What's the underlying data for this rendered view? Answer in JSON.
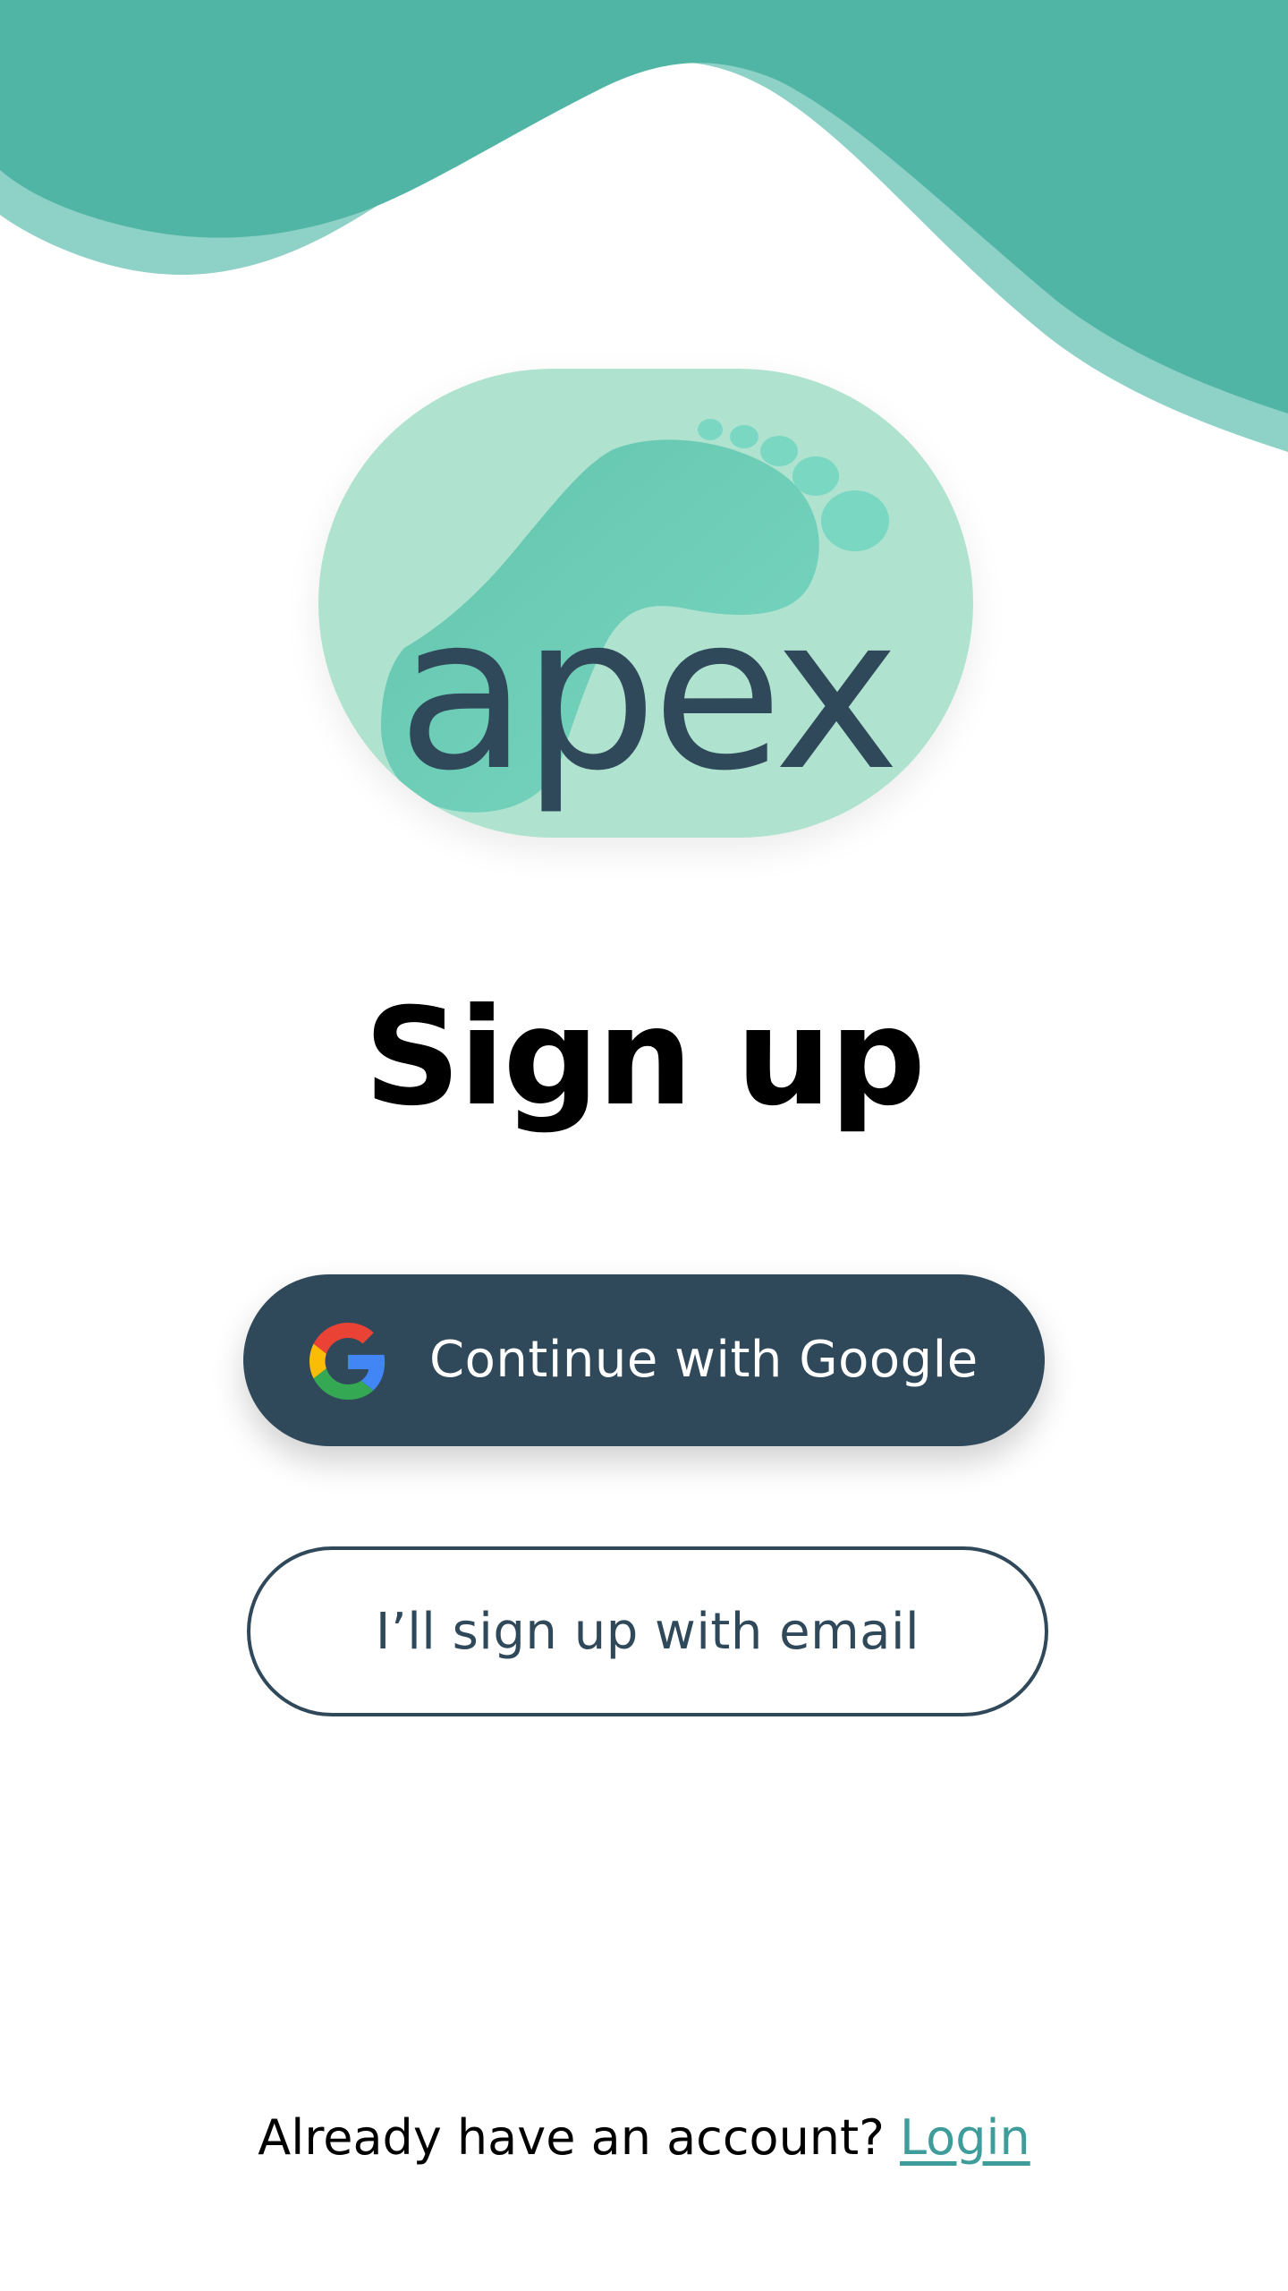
{
  "colors": {
    "wave_dark": "#51b5a6",
    "wave_light": "#8ed1c6",
    "badge_bg": "#afe3cf",
    "foot": "#6fcdb8",
    "navy": "#30495a",
    "link": "#3e9c9a"
  },
  "logo": {
    "wordmark": "apex",
    "icon": "footprint-icon"
  },
  "page": {
    "title": "Sign up"
  },
  "buttons": {
    "google": {
      "icon": "google-icon",
      "label": "Continue with Google"
    },
    "email": {
      "label": "I’ll sign up with email"
    }
  },
  "footer": {
    "prompt": "Already have an account?",
    "link_label": "Login"
  }
}
